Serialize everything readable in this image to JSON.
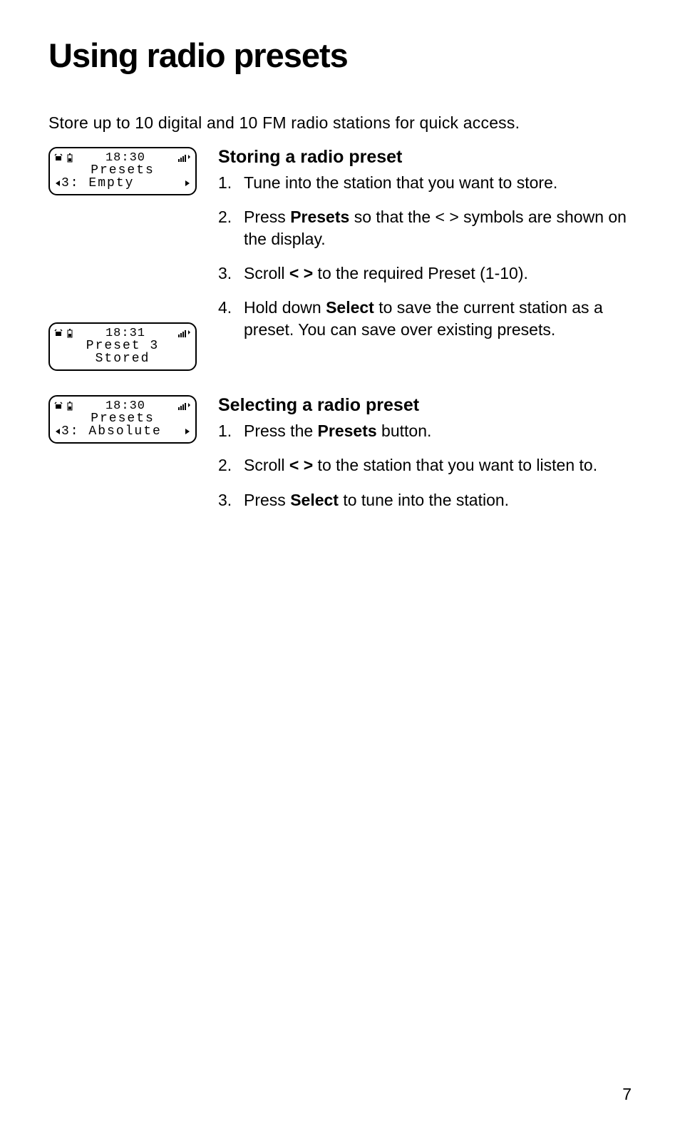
{
  "title": "Using radio presets",
  "intro": "Store up to 10 digital and 10 FM radio stations for quick access.",
  "lcd1": {
    "time": "18:30",
    "line2": "Presets",
    "line3_prefix": "3:",
    "line3_value": "Empty",
    "show_left_arrow": true,
    "show_right_arrow": true
  },
  "lcd2": {
    "time": "18:31",
    "line2": "Preset 3",
    "line3": "Stored"
  },
  "lcd3": {
    "time": "18:30",
    "line2": "Presets",
    "line3_prefix": "3:",
    "line3_value": "Absolute",
    "show_left_arrow": true,
    "show_right_arrow": true
  },
  "section1": {
    "heading": "Storing a radio preset",
    "step1": "Tune into the station that you want to store.",
    "step2a": "Press ",
    "step2b": "Presets",
    "step2c": " so that the < > symbols are shown on the display.",
    "step3a": "Scroll ",
    "step3b": "< >",
    "step3c": " to the required Preset (1-10).",
    "step4a": "Hold down ",
    "step4b": "Select",
    "step4c": " to save the current station as a preset. You can save over existing presets."
  },
  "section2": {
    "heading": "Selecting a radio preset",
    "step1a": "Press the ",
    "step1b": "Presets",
    "step1c": " button.",
    "step2a": "Scroll  ",
    "step2b": "< >",
    "step2c": " to the station that you want to listen to.",
    "step3a": "Press ",
    "step3b": "Select",
    "step3c": " to tune into the station."
  },
  "page_number": "7"
}
